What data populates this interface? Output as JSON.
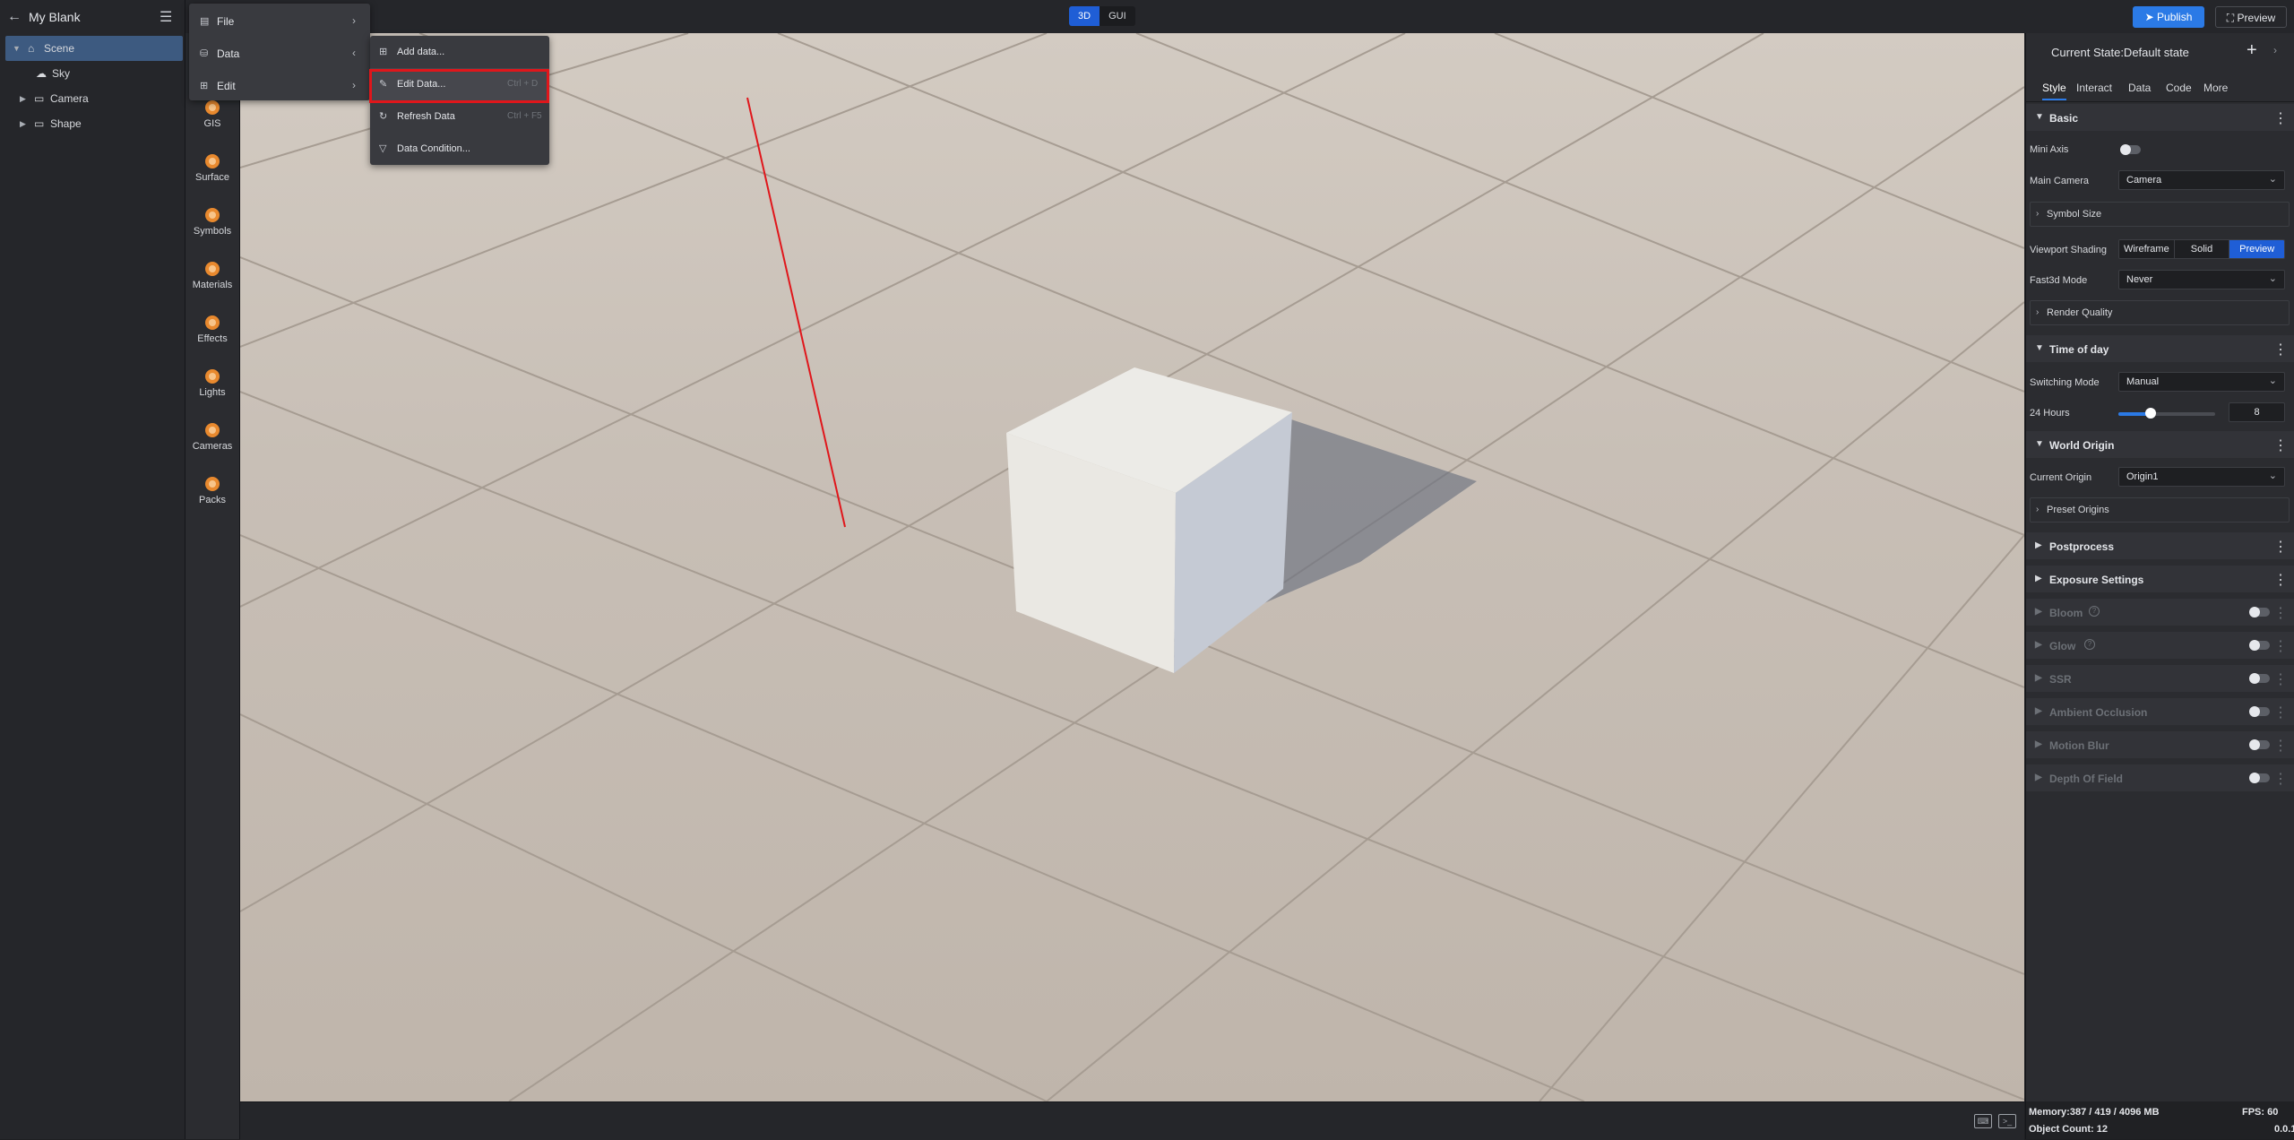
{
  "app": {
    "title": "My Blank"
  },
  "tree": [
    {
      "label": "Scene",
      "selected": true
    },
    {
      "label": "Sky"
    },
    {
      "label": "Camera"
    },
    {
      "label": "Shape"
    }
  ],
  "tools": [
    {
      "label": "GIS"
    },
    {
      "label": "Surface"
    },
    {
      "label": "Symbols"
    },
    {
      "label": "Materials"
    },
    {
      "label": "Effects"
    },
    {
      "label": "Lights"
    },
    {
      "label": "Cameras"
    },
    {
      "label": "Packs"
    }
  ],
  "mode_switch": {
    "options": [
      "3D",
      "GUI"
    ],
    "active": "3D"
  },
  "header_buttons": {
    "publish": "Publish",
    "preview": "Preview"
  },
  "menu": {
    "items": [
      {
        "label": "File"
      },
      {
        "label": "Data"
      },
      {
        "label": "Edit"
      }
    ],
    "submenu": [
      {
        "label": "Add data..."
      },
      {
        "label": "Edit Data...",
        "shortcut": "Ctrl + D",
        "highlighted": true
      },
      {
        "label": "Refresh Data",
        "shortcut": "Ctrl + F5"
      },
      {
        "label": "Data Condition..."
      }
    ]
  },
  "right": {
    "state_label": "Current State:Default state",
    "tabs": [
      "Style",
      "Interact",
      "Data",
      "Code",
      "More"
    ],
    "active_tab": "Style",
    "basic": {
      "title": "Basic",
      "mini_axis_label": "Mini Axis",
      "main_camera_label": "Main Camera",
      "main_camera_value": "Camera",
      "symbol_size_label": "Symbol Size",
      "viewport_shading_label": "Viewport Shading",
      "viewport_shading_options": [
        "Wireframe",
        "Solid",
        "Preview"
      ],
      "viewport_shading_active": "Preview",
      "fast3d_label": "Fast3d Mode",
      "fast3d_value": "Never",
      "render_quality_label": "Render Quality"
    },
    "time_of_day": {
      "title": "Time of day",
      "switching_mode_label": "Switching Mode",
      "switching_mode_value": "Manual",
      "hours_label": "24 Hours",
      "hours_value": "8",
      "hours_fraction": 0.333
    },
    "world_origin": {
      "title": "World Origin",
      "current_origin_label": "Current Origin",
      "current_origin_value": "Origin1",
      "preset_origins_label": "Preset Origins"
    },
    "sections": [
      "Postprocess",
      "Exposure Settings"
    ],
    "effects": [
      {
        "label": "Bloom",
        "info": true
      },
      {
        "label": "Glow",
        "info": true
      },
      {
        "label": "SSR"
      },
      {
        "label": "Ambient Occlusion"
      },
      {
        "label": "Motion Blur"
      },
      {
        "label": "Depth Of Field"
      }
    ]
  },
  "footer": {
    "memory": "Memory:387 / 419 / 4096 MB",
    "fps": "FPS: 60",
    "object_count": "Object Count: 12",
    "version": "0.0.1"
  },
  "colors": {
    "accent": "#2b7ae6",
    "active_seg": "#1f5ed6",
    "highlight_box": "#e0161b",
    "tool_icon": "#e8892e"
  }
}
